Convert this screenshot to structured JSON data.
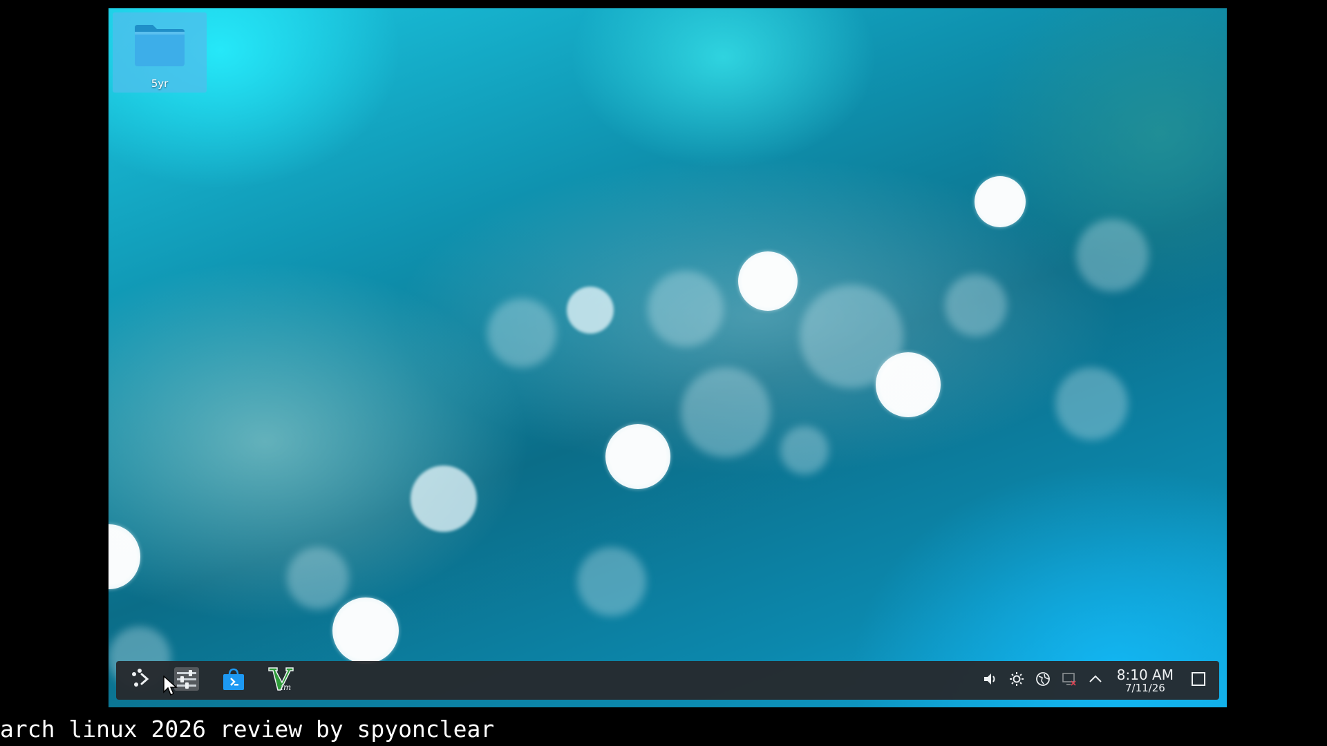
{
  "desktop": {
    "icons": [
      {
        "label": "5yr",
        "icon": "folder-icon"
      }
    ]
  },
  "panel": {
    "launchers": [
      {
        "name": "application-launcher",
        "icon": "kde-launcher-icon"
      },
      {
        "name": "system-settings",
        "icon": "settings-sliders-icon"
      },
      {
        "name": "discover-store",
        "icon": "shopping-bag-icon"
      },
      {
        "name": "vim",
        "icon": "vim-icon"
      }
    ],
    "tray": [
      {
        "name": "volume",
        "icon": "speaker-icon"
      },
      {
        "name": "brightness",
        "icon": "sun-icon"
      },
      {
        "name": "network",
        "icon": "globe-disconnected-icon"
      },
      {
        "name": "display",
        "icon": "display-disconnected-icon"
      },
      {
        "name": "expand-tray",
        "icon": "chevron-up-icon"
      }
    ],
    "clock": {
      "time": "8:10 AM",
      "date": "7/11/26"
    },
    "show_desktop_icon": "show-desktop-icon"
  },
  "caption": "arch linux 2026 review by spyonclear",
  "colors": {
    "panel_bg": "#262a2e",
    "folder_blue": "#3daee9",
    "icon_highlight": "#50bfeb"
  }
}
